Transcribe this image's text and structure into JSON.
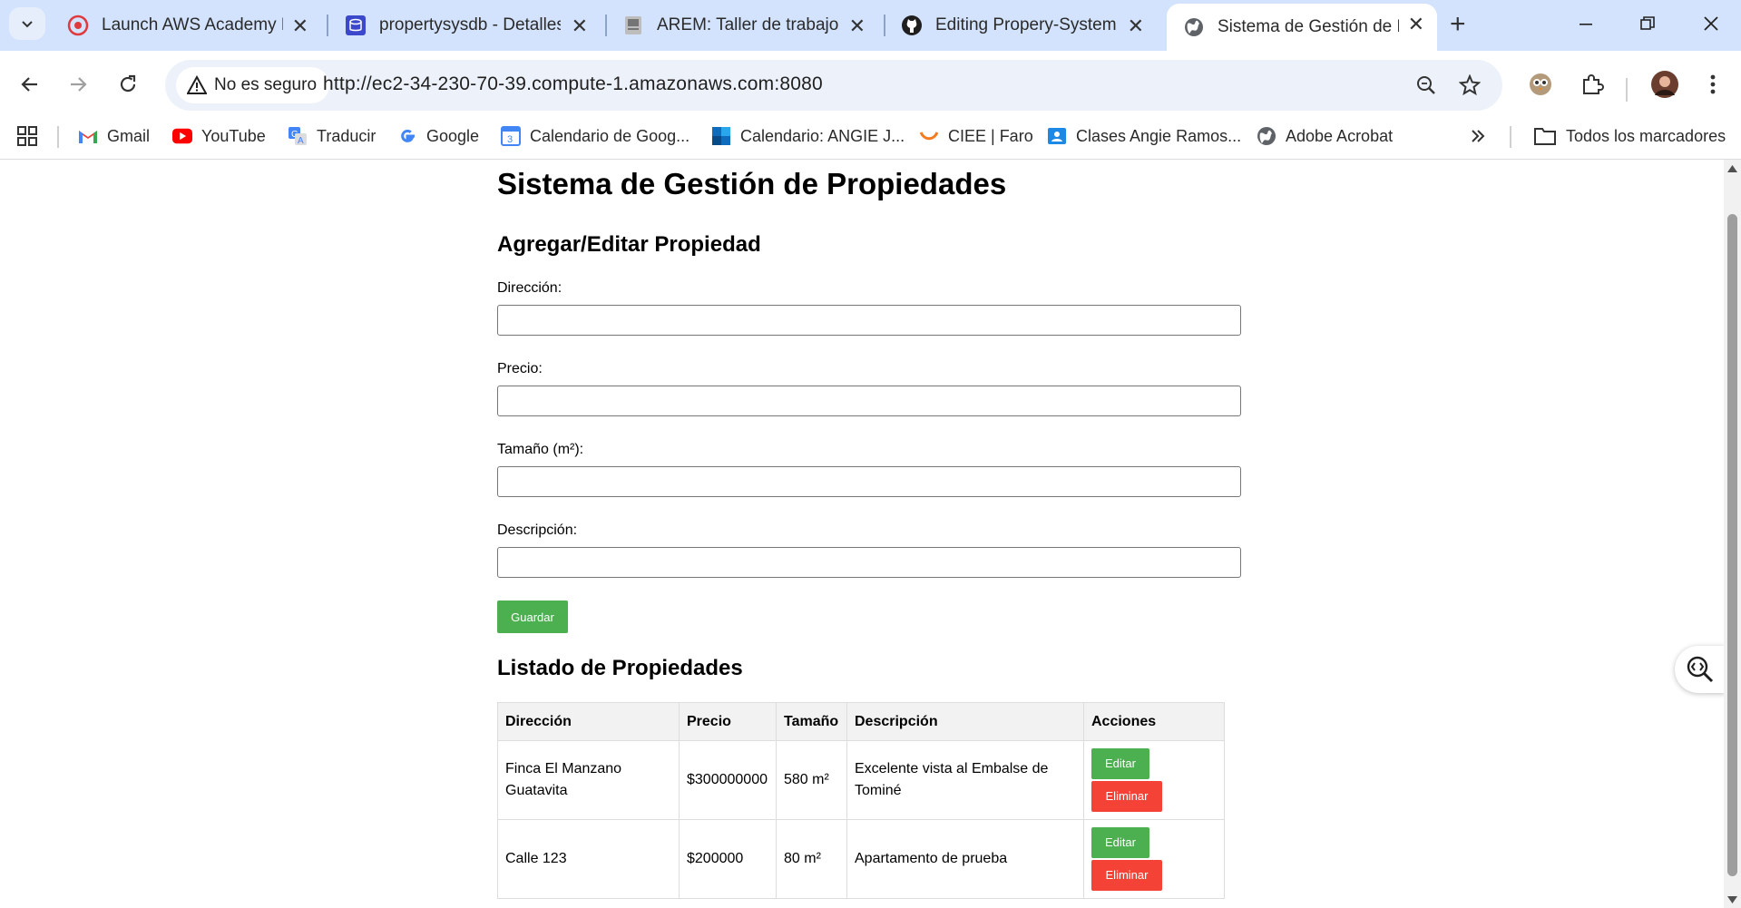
{
  "browser": {
    "tabs": [
      {
        "title": "Launch AWS Academy Le",
        "icon": "aws-academy-icon",
        "active": false
      },
      {
        "title": "propertysysdb - Detalles",
        "icon": "rds-database-icon",
        "active": false
      },
      {
        "title": "AREM: Taller de trabajo ir",
        "icon": "document-icon",
        "active": false
      },
      {
        "title": "Editing Propery-System-/",
        "icon": "github-icon",
        "active": false
      },
      {
        "title": "Sistema de Gestión de Pr",
        "icon": "globe-icon",
        "active": true
      }
    ],
    "security_chip": "No es seguro",
    "url": "http://ec2-34-230-70-39.compute-1.amazonaws.com:8080",
    "bookmarks": [
      {
        "label": "Gmail",
        "icon": "gmail-icon"
      },
      {
        "label": "YouTube",
        "icon": "youtube-icon"
      },
      {
        "label": "Traducir",
        "icon": "translate-icon"
      },
      {
        "label": "Google",
        "icon": "google-icon"
      },
      {
        "label": "Calendario de Goog...",
        "icon": "calendar-icon"
      },
      {
        "label": "Calendario: ANGIE J...",
        "icon": "outlook-icon"
      },
      {
        "label": "CIEE | Faro",
        "icon": "ciee-icon"
      },
      {
        "label": "Clases Angie Ramos...",
        "icon": "classroom-icon"
      },
      {
        "label": "Adobe Acrobat",
        "icon": "globe-icon"
      }
    ],
    "all_bookmarks": "Todos los marcadores"
  },
  "page": {
    "title": "Sistema de Gestión de Propiedades",
    "form": {
      "heading": "Agregar/Editar Propiedad",
      "address_label": "Dirección:",
      "address_value": "",
      "price_label": "Precio:",
      "price_value": "",
      "size_label": "Tamaño (m²):",
      "size_value": "",
      "description_label": "Descripción:",
      "description_value": "",
      "save_button": "Guardar"
    },
    "listing": {
      "heading": "Listado de Propiedades",
      "columns": [
        "Dirección",
        "Precio",
        "Tamaño",
        "Descripción",
        "Acciones"
      ],
      "rows": [
        {
          "address": "Finca El Manzano Guatavita",
          "price": "$300000000",
          "size": "580 m²",
          "description": "Excelente vista al Embalse de Tominé",
          "edit": "Editar",
          "delete": "Eliminar"
        },
        {
          "address": "Calle 123",
          "price": "$200000",
          "size": "80 m²",
          "description": "Apartamento de prueba",
          "edit": "Editar",
          "delete": "Eliminar"
        }
      ]
    }
  },
  "colors": {
    "tabstrip": "#d3e3fd",
    "omnibox": "#edf2fa",
    "save_button": "#4caf50",
    "edit_button": "#4caf50",
    "delete_button": "#f44336"
  }
}
